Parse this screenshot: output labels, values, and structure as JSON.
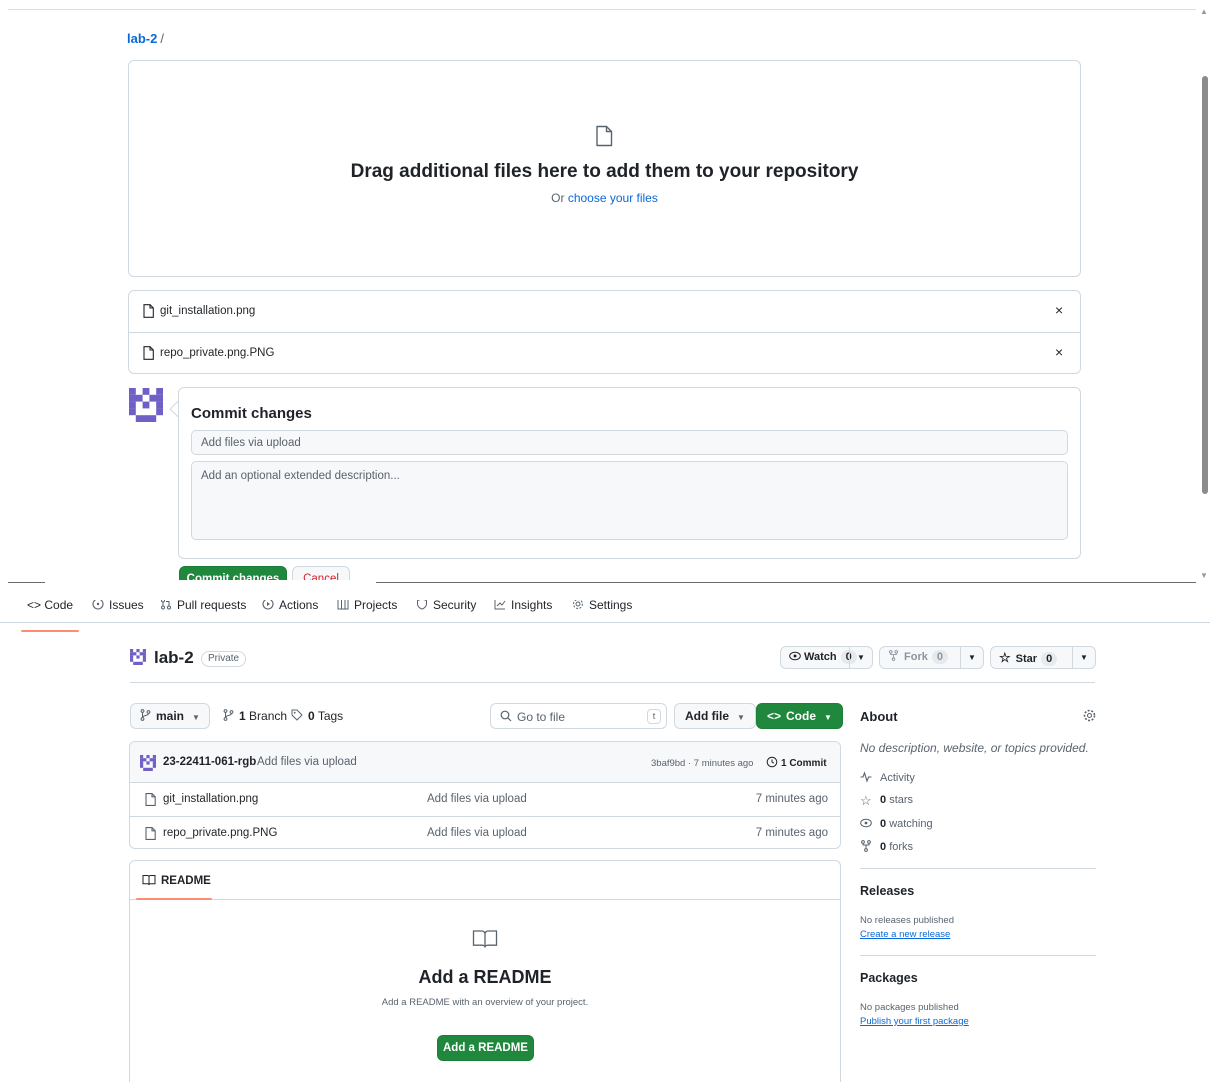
{
  "upload": {
    "breadcrumb_repo": "lab-2",
    "breadcrumb_sep": "/",
    "dropzone_title": "Drag additional files here to add them to your repository",
    "dropzone_or": "Or",
    "dropzone_link": "choose your files",
    "files": [
      {
        "name": "git_installation.png",
        "remove": "×"
      },
      {
        "name": "repo_private.png.PNG",
        "remove": "×"
      }
    ],
    "commit_title": "Commit changes",
    "commit_placeholder": "Add files via upload",
    "description_placeholder": "Add an optional extended description...",
    "commit_button": "Commit changes",
    "cancel_button": "Cancel",
    "scroll_up": "▲",
    "scroll_down": "▼"
  },
  "repo": {
    "tabs": [
      "<> Code",
      "Issues",
      "Pull requests",
      "Actions",
      "Projects",
      "Security",
      "Insights",
      "Settings"
    ],
    "name": "lab-2",
    "visibility": "Private",
    "watch": {
      "label": "Watch",
      "count": "0"
    },
    "fork": {
      "label": "Fork",
      "count": "0"
    },
    "star": {
      "label": "Star",
      "count": "0"
    },
    "branch_button": "main",
    "branches": {
      "count": "1",
      "label": "Branch"
    },
    "tags": {
      "count": "0",
      "label": "Tags"
    },
    "goto_placeholder": "Go to file",
    "goto_kbd": "t",
    "add_file": "Add file",
    "code_button": "Code",
    "latest_commit": {
      "author": "23-22411-061-rgb",
      "message": "Add files via upload",
      "sha_time": "3baf9bd · 7 minutes ago",
      "count_label": "1 Commit"
    },
    "file_rows": [
      {
        "name": "git_installation.png",
        "message": "Add files via upload",
        "time": "7 minutes ago"
      },
      {
        "name": "repo_private.png.PNG",
        "message": "Add files via upload",
        "time": "7 minutes ago"
      }
    ],
    "readme_tab": "README",
    "readme_title": "Add a README",
    "readme_sub": "Add a README with an overview of your project.",
    "readme_button": "Add a README",
    "about": {
      "title": "About",
      "description": "No description, website, or topics provided.",
      "activity": "Activity",
      "stars_count": "0",
      "stars_label": "stars",
      "watching_count": "0",
      "watching_label": "watching",
      "forks_count": "0",
      "forks_label": "forks"
    },
    "releases": {
      "title": "Releases",
      "empty": "No releases published",
      "link": "Create a new release"
    },
    "packages": {
      "title": "Packages",
      "empty": "No packages published",
      "link": "Publish your first package"
    }
  },
  "colors": {
    "accent_green": "#1f883d",
    "link_blue": "#0969da",
    "danger_red": "#d1242f",
    "tab_underline": "#fd8c73",
    "avatar_purple": "#6f5fc7"
  }
}
